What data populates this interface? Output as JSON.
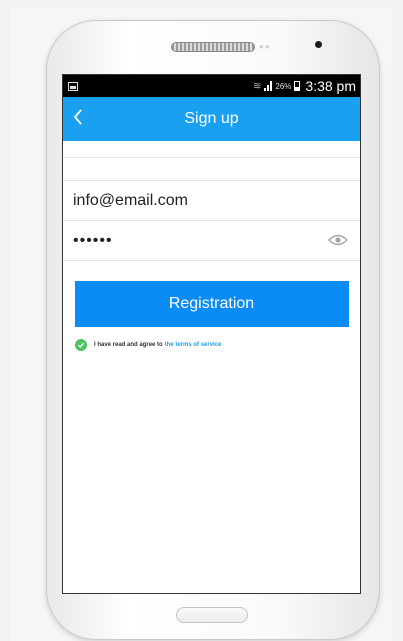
{
  "status_bar": {
    "battery": "26%",
    "time": "3:38 pm"
  },
  "app_bar": {
    "title": "Sign up"
  },
  "form": {
    "email_value": "info@email.com",
    "password_value": "••••••"
  },
  "actions": {
    "registration_label": "Registration"
  },
  "agreement": {
    "text": "I have read and agree to",
    "link": "the terms of service"
  },
  "colors": {
    "primary": "#1aa0f0",
    "button": "#0b8bf4",
    "check": "#4fc361"
  },
  "icons": [
    "back-icon",
    "eye-icon",
    "check-icon",
    "signal-icon",
    "battery-icon",
    "wifi-icon",
    "notification-icon"
  ]
}
